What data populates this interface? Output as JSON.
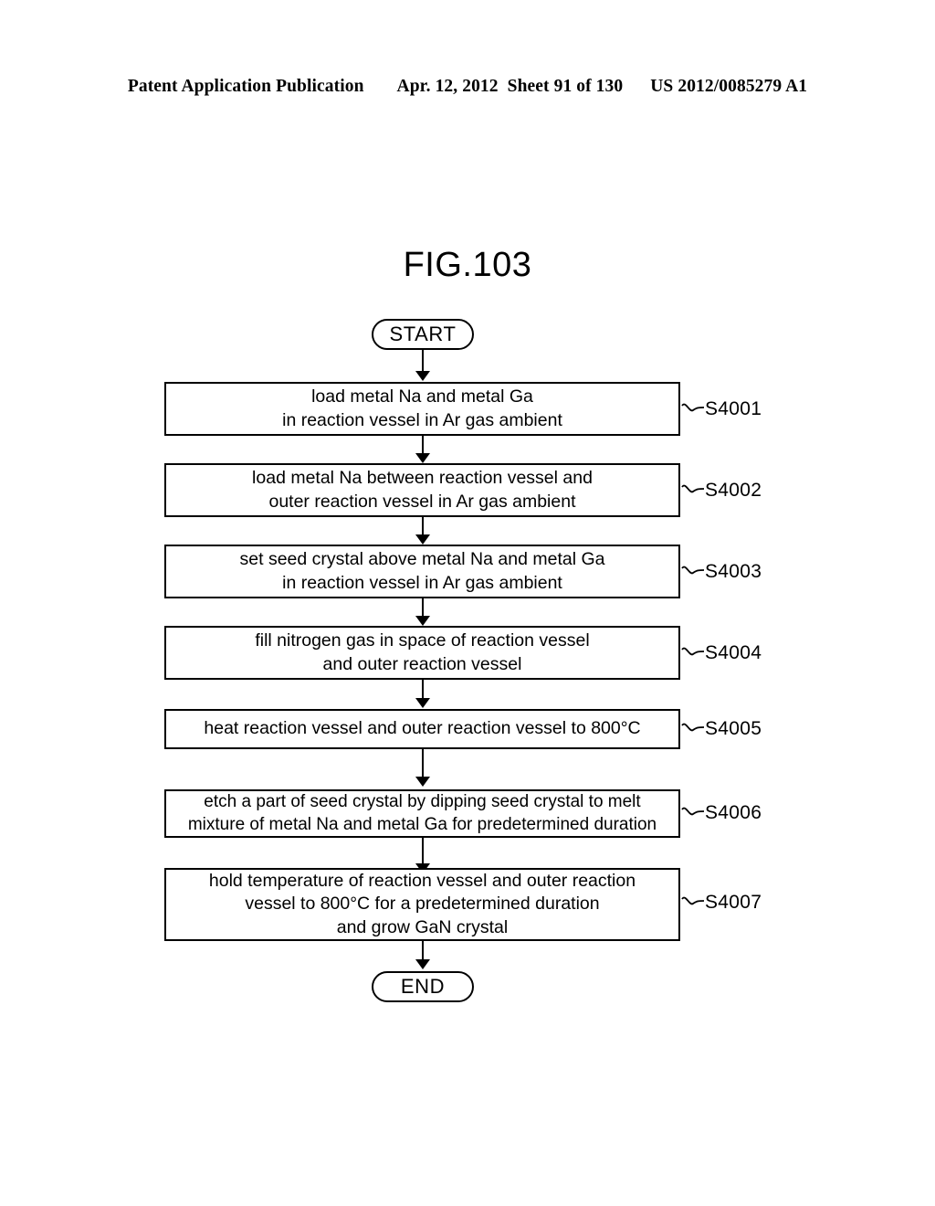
{
  "header": {
    "publication": "Patent Application Publication",
    "date": "Apr. 12, 2012",
    "sheet": "Sheet 91 of 130",
    "patent_number": "US 2012/0085279 A1"
  },
  "figure": {
    "title": "FIG.103"
  },
  "flowchart": {
    "start_label": "START",
    "end_label": "END",
    "steps": [
      {
        "id": "S4001",
        "text": "load metal Na and metal Ga\nin reaction vessel in Ar gas ambient"
      },
      {
        "id": "S4002",
        "text": "load metal Na between reaction vessel and\nouter reaction vessel in Ar gas ambient"
      },
      {
        "id": "S4003",
        "text": "set seed crystal above metal Na and metal Ga\nin reaction vessel in Ar gas ambient"
      },
      {
        "id": "S4004",
        "text": "fill nitrogen gas in space of reaction vessel\nand outer reaction vessel"
      },
      {
        "id": "S4005",
        "text": "heat reaction vessel and outer reaction vessel to 800°C"
      },
      {
        "id": "S4006",
        "text": "etch a part of seed crystal by dipping seed crystal to melt\nmixture of metal Na and metal Ga for predetermined duration"
      },
      {
        "id": "S4007",
        "text": "hold temperature of reaction vessel and outer reaction\nvessel to 800°C for a predetermined duration\nand grow GaN crystal"
      }
    ]
  },
  "colors": {
    "ink": "#000000",
    "paper": "#ffffff"
  }
}
